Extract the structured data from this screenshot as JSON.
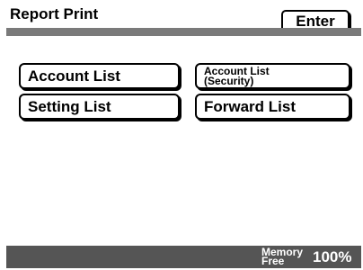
{
  "header": {
    "title": "Report Print",
    "enter_label": "Enter"
  },
  "buttons": {
    "account_list": "Account List",
    "account_list_security_line1": "Account List",
    "account_list_security_line2": "(Security)",
    "setting_list": "Setting List",
    "forward_list": "Forward List"
  },
  "status": {
    "memory_line1": "Memory",
    "memory_line2": "Free",
    "memory_value": "100%"
  },
  "colors": {
    "title_bar": "#7a7a7a",
    "status_bar": "#555555",
    "background": "#ffffff"
  }
}
